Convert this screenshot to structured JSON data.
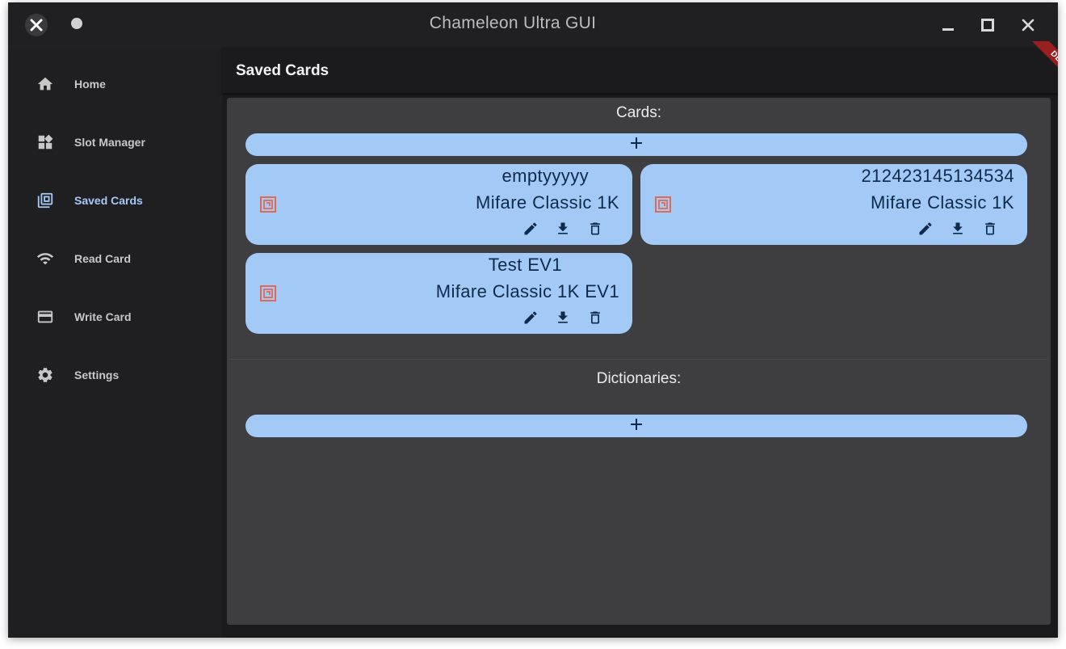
{
  "window": {
    "title": "Chameleon Ultra GUI"
  },
  "sidebar": {
    "items": [
      {
        "label": "Home",
        "icon": "home-icon"
      },
      {
        "label": "Slot Manager",
        "icon": "widgets-icon"
      },
      {
        "label": "Saved Cards",
        "icon": "library-icon",
        "active": true
      },
      {
        "label": "Read Card",
        "icon": "wifi-icon"
      },
      {
        "label": "Write Card",
        "icon": "credit-card-icon"
      },
      {
        "label": "Settings",
        "icon": "gear-icon"
      }
    ]
  },
  "main": {
    "title": "Saved Cards",
    "debug_banner": "DEBUG",
    "cards_heading": "Cards:",
    "dictionaries_heading": "Dictionaries:",
    "add_symbol": "+",
    "cards": [
      {
        "name": "emptyyyyy",
        "type": "Mifare Classic 1K"
      },
      {
        "name": "212423145134534",
        "type": "Mifare Classic 1K"
      },
      {
        "name": "Test EV1",
        "type": "Mifare Classic 1K EV1"
      }
    ]
  },
  "colors": {
    "accent": "#a3c9f7",
    "active_nav": "#a6c9f5",
    "nfc_icon": "#e26a55",
    "card_text": "#0e2a4a",
    "panel": "#3e3e40",
    "background": "#1f1f21"
  }
}
